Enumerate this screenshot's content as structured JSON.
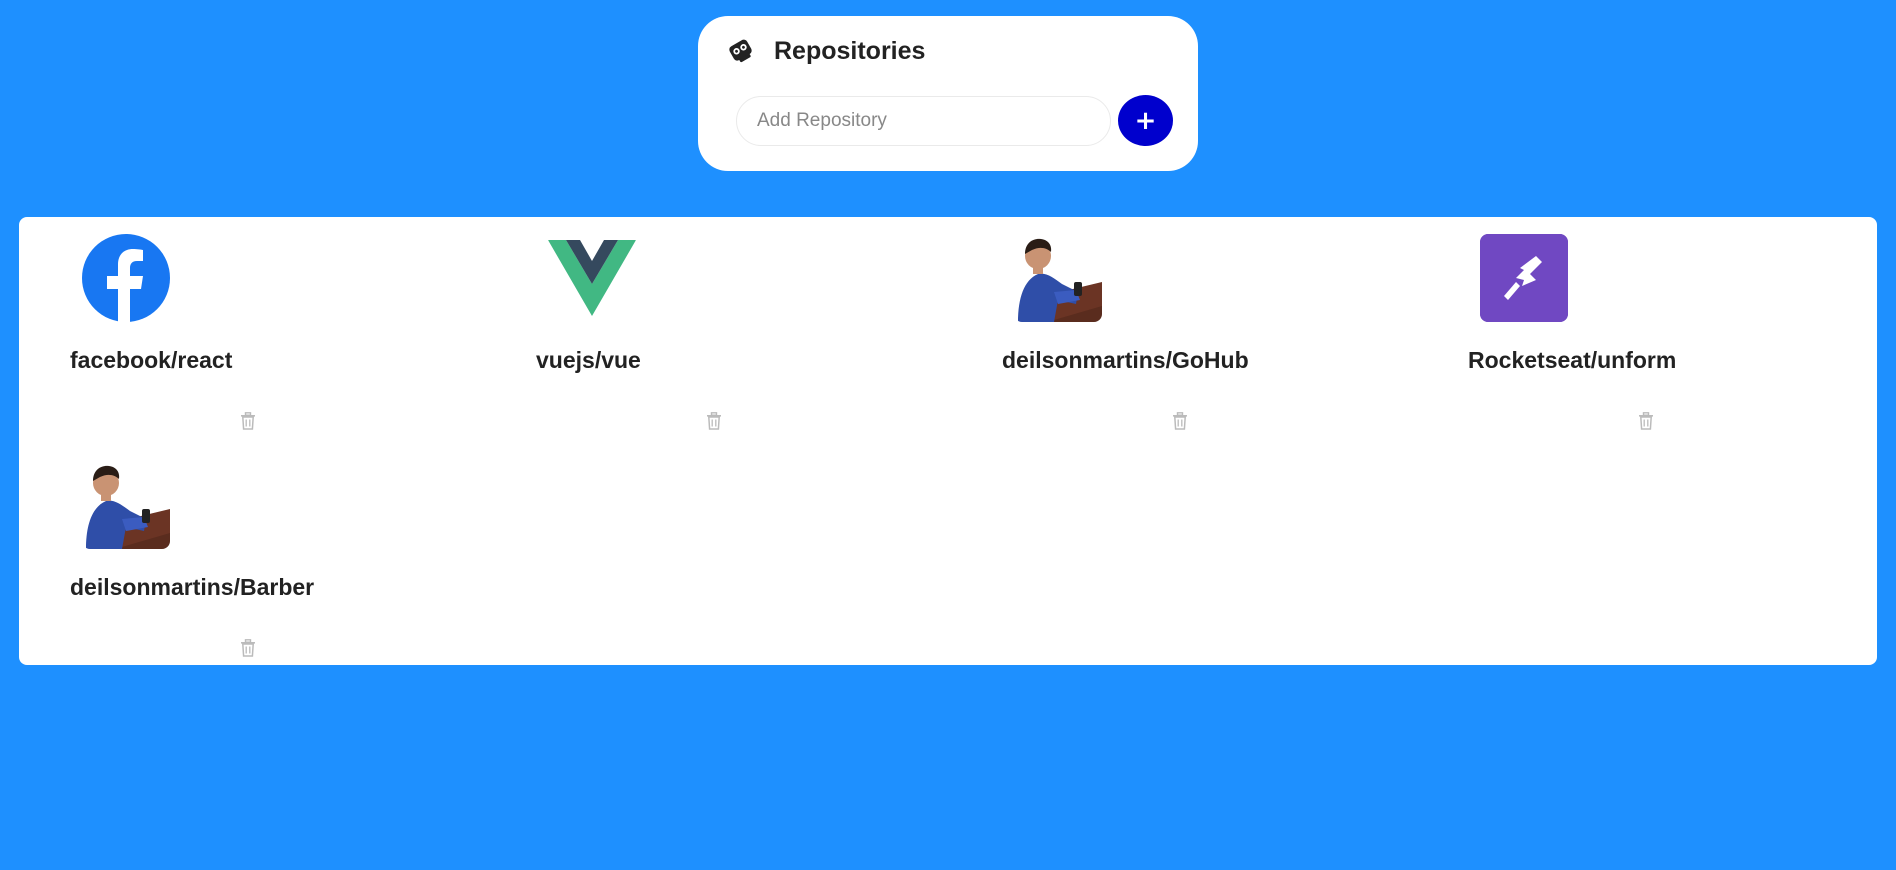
{
  "header": {
    "title": "Repositories",
    "icon": "repository-icon"
  },
  "form": {
    "placeholder": "Add Repository",
    "value": "",
    "add_button_label": "+"
  },
  "colors": {
    "background": "#1e90ff",
    "add_button": "#0000cd",
    "facebook": "#1877f2",
    "vue_green": "#41b883",
    "vue_dark": "#35495e",
    "rocketseat": "#7048c2"
  },
  "repositories": [
    {
      "name": "facebook/react",
      "avatar": "facebook-logo-icon"
    },
    {
      "name": "vuejs/vue",
      "avatar": "vue-logo-icon"
    },
    {
      "name": "deilsonmartins/GoHub",
      "avatar": "user-photo"
    },
    {
      "name": "Rocketseat/unform",
      "avatar": "rocketseat-logo-icon"
    },
    {
      "name": "deilsonmartins/Barber",
      "avatar": "user-photo"
    }
  ]
}
